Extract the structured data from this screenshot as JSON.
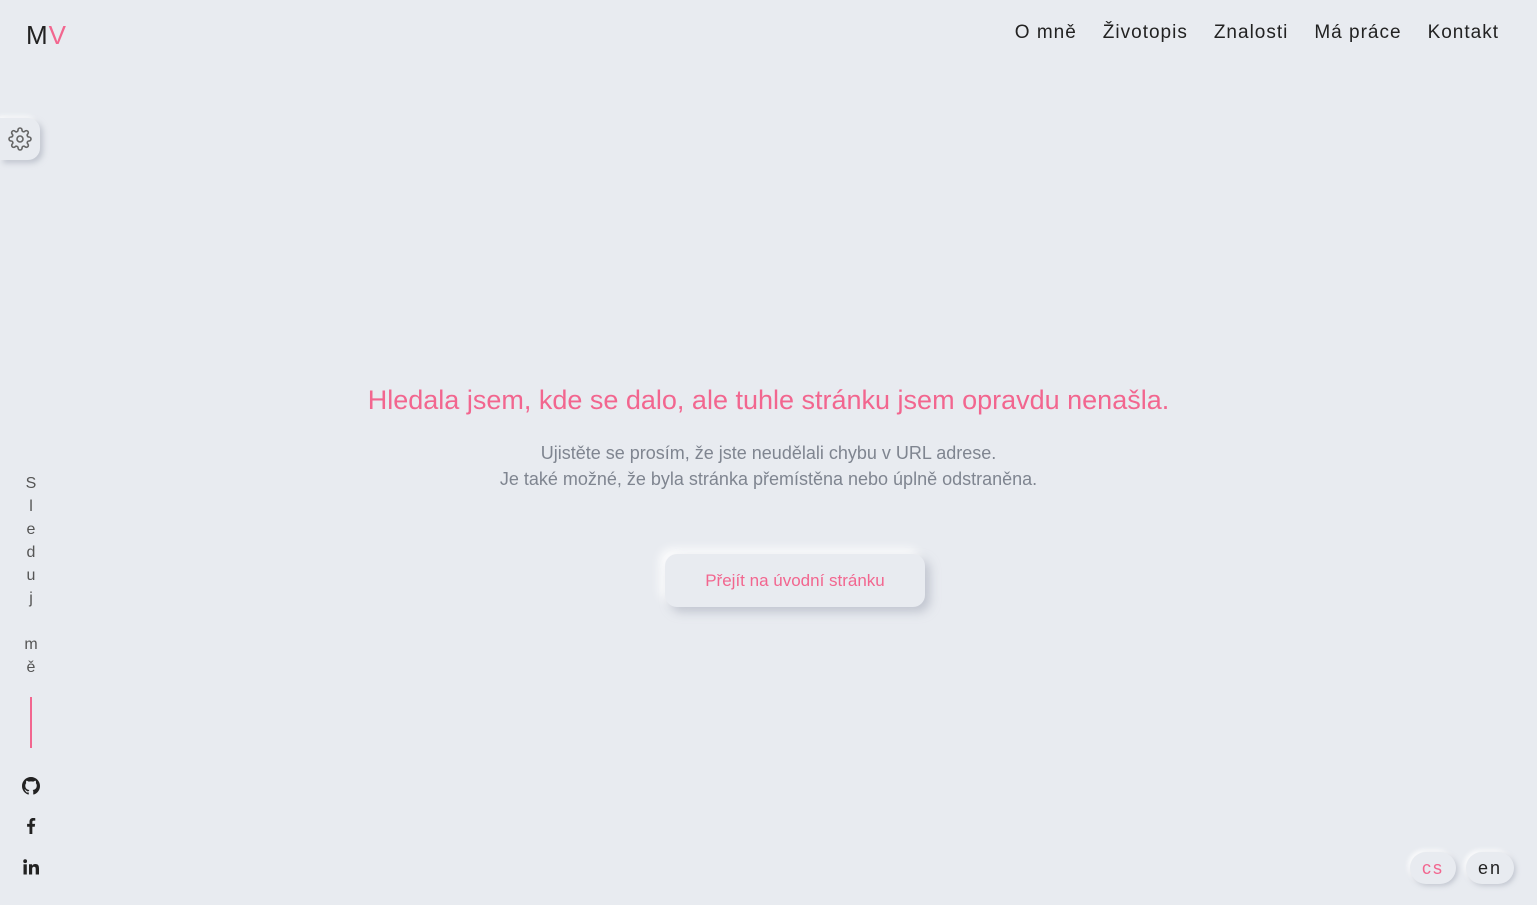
{
  "logo": {
    "first": "M",
    "second": "V"
  },
  "nav": {
    "items": [
      {
        "label": "O mně"
      },
      {
        "label": "Životopis"
      },
      {
        "label": "Znalosti"
      },
      {
        "label": "Má práce"
      },
      {
        "label": "Kontakt"
      }
    ]
  },
  "sidebar": {
    "follow_top": [
      "S",
      "l",
      "e",
      "d",
      "u",
      "j"
    ],
    "follow_bottom": [
      "m",
      "ě"
    ]
  },
  "error": {
    "title": "Hledala jsem, kde se dalo, ale tuhle stránku jsem opravdu nenašla.",
    "line1": "Ujistěte se prosím, že jste neudělali chybu v URL adrese.",
    "line2": "Je také možné, že byla stránka přemístěna nebo úplně odstraněna.",
    "button_label": "Přejít na úvodní stránku"
  },
  "languages": {
    "cs": "cs",
    "en": "en",
    "active": "cs"
  },
  "icons": {
    "settings": "gear-icon",
    "github": "github-icon",
    "facebook": "facebook-icon",
    "linkedin": "linkedin-icon"
  },
  "colors": {
    "accent": "#f2668f",
    "background": "#e8ebf0",
    "text": "#222222",
    "muted": "#7f8590"
  }
}
